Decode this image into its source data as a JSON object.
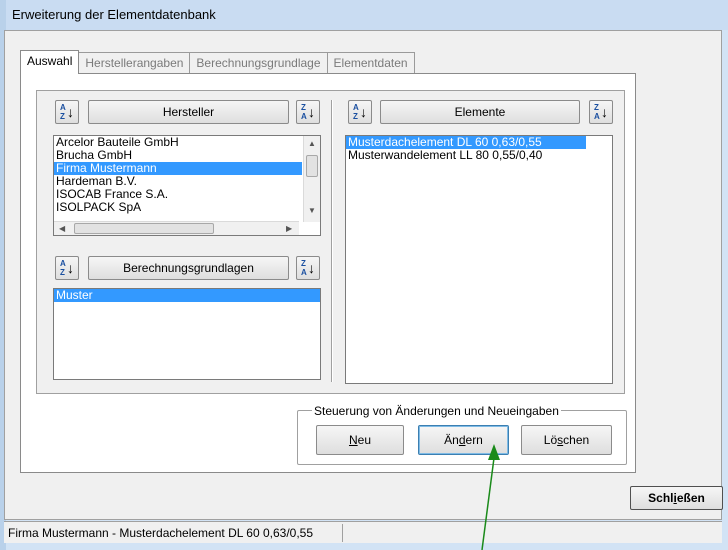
{
  "window": {
    "title": "Erweiterung der Elementdatenbank"
  },
  "tabs": [
    {
      "label": "Auswahl",
      "active": true
    },
    {
      "label": "Herstellerangaben",
      "active": false
    },
    {
      "label": "Berechnungsgrundlage",
      "active": false
    },
    {
      "label": "Elementdaten",
      "active": false
    }
  ],
  "hersteller": {
    "header": "Hersteller",
    "items": [
      {
        "label": "Arcelor Bauteile GmbH",
        "selected": false
      },
      {
        "label": "Brucha GmbH",
        "selected": false
      },
      {
        "label": "Firma Mustermann",
        "selected": true
      },
      {
        "label": "Hardeman B.V.",
        "selected": false
      },
      {
        "label": "ISOCAB France S.A.",
        "selected": false
      },
      {
        "label": "ISOLPACK SpA",
        "selected": false
      }
    ]
  },
  "berechnungsgrundlagen": {
    "header": "Berechnungsgrundlagen",
    "items": [
      {
        "label": "Muster",
        "selected": true
      }
    ]
  },
  "elemente": {
    "header": "Elemente",
    "items": [
      {
        "label": "Musterdachelement DL 60 0,63/0,55",
        "selected": true
      },
      {
        "label": "Musterwandelement LL 80 0,55/0,40",
        "selected": false
      }
    ]
  },
  "steuerung": {
    "label": "Steuerung von Änderungen und Neueingaben",
    "neu_mnemonic": "N",
    "neu_rest": "eu",
    "aendern_pre": "Än",
    "aendern_mnemonic": "d",
    "aendern_rest": "ern",
    "loeschen_pre": "Lö",
    "loeschen_mnemonic": "s",
    "loeschen_rest": "chen"
  },
  "close": {
    "pre": "Schl",
    "mnemonic": "i",
    "rest": "eßen"
  },
  "status": {
    "text": "Firma Mustermann - Musterdachelement DL 60 0,63/0,55"
  },
  "colors": {
    "selection": "#3399ff",
    "annotation_arrow": "#1a8a1a"
  },
  "icons": {
    "sort_ascending": "sort-az-icon",
    "sort_descending": "sort-za-icon"
  }
}
